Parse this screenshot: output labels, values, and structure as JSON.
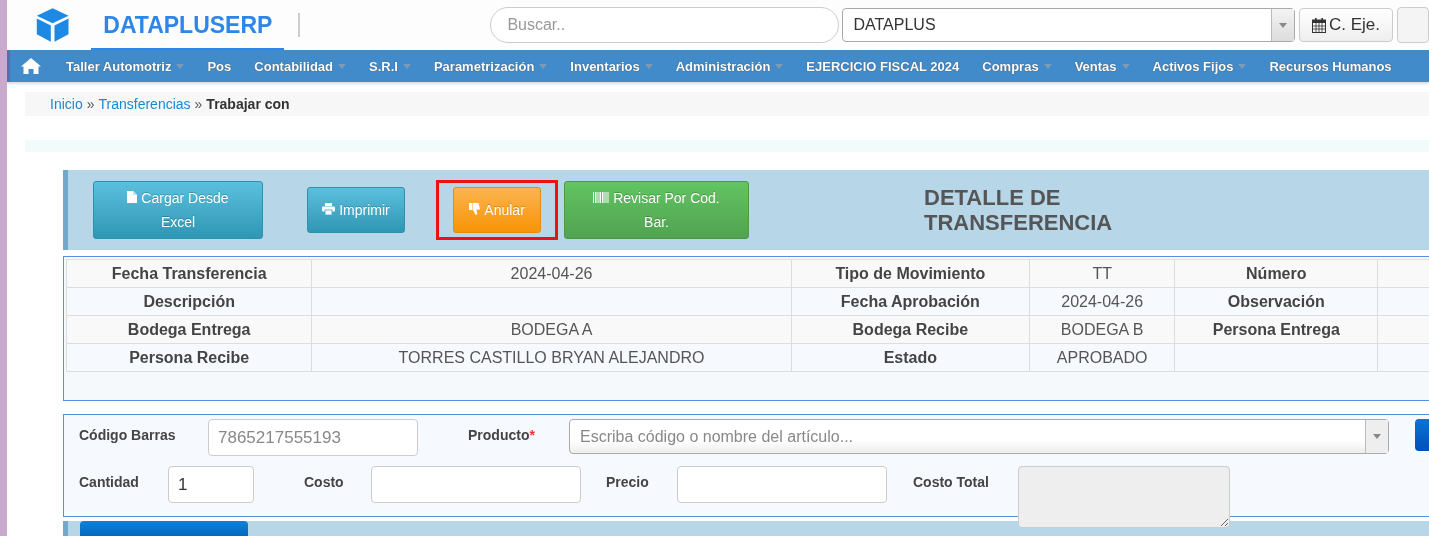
{
  "header": {
    "brand": "DATAPLUSERP",
    "search": {
      "placeholder": "Buscar.."
    },
    "company_select": {
      "value": "DATAPLUS"
    },
    "fiscal_button": {
      "label": "C. Eje."
    }
  },
  "nav": {
    "items": [
      {
        "label": "Taller Automotriz",
        "dropdown": true
      },
      {
        "label": "Pos",
        "dropdown": false
      },
      {
        "label": "Contabilidad",
        "dropdown": true
      },
      {
        "label": "S.R.I",
        "dropdown": true
      },
      {
        "label": "Parametrización",
        "dropdown": true
      },
      {
        "label": "Inventarios",
        "dropdown": true
      },
      {
        "label": "Administración",
        "dropdown": true
      },
      {
        "label": "EJERCICIO FISCAL 2024",
        "dropdown": false
      },
      {
        "label": "Compras",
        "dropdown": true
      },
      {
        "label": "Ventas",
        "dropdown": true
      },
      {
        "label": "Activos Fijos",
        "dropdown": true
      },
      {
        "label": "Recursos Humanos",
        "dropdown": false
      }
    ]
  },
  "breadcrumb": [
    {
      "label": "Inicio",
      "kind": "link"
    },
    {
      "label": "»",
      "kind": "separator"
    },
    {
      "label": "Transferencias",
      "kind": "link"
    },
    {
      "label": "»",
      "kind": "separator"
    },
    {
      "label": "Trabajar con",
      "kind": "current"
    }
  ],
  "toolbar": {
    "buttons": [
      {
        "label": "Cargar Desde Excel",
        "kind": "excel",
        "highlighted": false
      },
      {
        "label": "Imprimir",
        "kind": "print",
        "highlighted": false
      },
      {
        "label": "Anular",
        "kind": "void",
        "highlighted": true
      },
      {
        "label": "Revisar Por Cod. Bar.",
        "kind": "barcode",
        "highlighted": false
      }
    ],
    "title": "DETALLE DE TRANSFERENCIA"
  },
  "details": {
    "rows": [
      [
        "Fecha Transferencia",
        "2024-04-26",
        "Tipo de Movimiento",
        "TT",
        "Número",
        ""
      ],
      [
        "Descripción",
        "",
        "Fecha Aprobación",
        "2024-04-26",
        "Observación",
        ""
      ],
      [
        "Bodega Entrega",
        "BODEGA A",
        "Bodega Recibe",
        "BODEGA B",
        "Persona Entrega",
        ""
      ],
      [
        "Persona Recibe",
        "TORRES CASTILLO BRYAN ALEJANDRO",
        "Estado",
        "APROBADO",
        "",
        ""
      ]
    ]
  },
  "form": {
    "barcode": {
      "label": "Código Barras",
      "placeholder": "7865217555193"
    },
    "product": {
      "label": "Producto",
      "required_mark": "*",
      "placeholder": "Escriba código o nombre del artículo..."
    },
    "quantity": {
      "label": "Cantidad",
      "value": "1"
    },
    "cost": {
      "label": "Costo"
    },
    "price": {
      "label": "Precio"
    },
    "total_cost": {
      "label": "Costo Total",
      "disabled": true
    }
  }
}
